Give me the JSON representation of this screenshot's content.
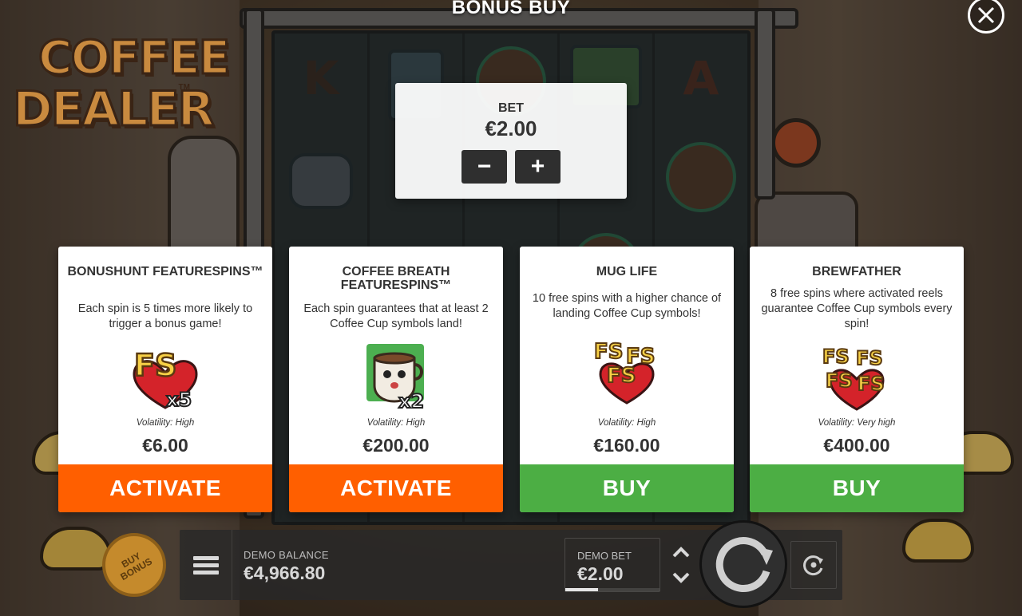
{
  "game": {
    "logo_line1": "COFFEE",
    "logo_line2": "DEALER",
    "logo_tm": "TM"
  },
  "reel_symbols": {
    "col1": [
      "K"
    ],
    "col5": [
      "A"
    ]
  },
  "modal": {
    "title": "BONUS BUY",
    "close_icon": "close-icon"
  },
  "bet": {
    "label": "BET",
    "value": "€2.00",
    "decrease_symbol": "−",
    "increase_symbol": "+"
  },
  "cards": [
    {
      "title": "BONUSHUNT FEATURESPINS™",
      "description": "Each spin is 5 times more likely to trigger a bonus game!",
      "icon": "fs-x5-icon",
      "icon_text": "FS",
      "icon_mult": "x5",
      "volatility": "Volatility: High",
      "price": "€6.00",
      "button": "ACTIVATE",
      "button_color": "#ff5f00"
    },
    {
      "title": "COFFEE BREATH FEATURESPINS™",
      "description": "Each spin guarantees that at least 2 Coffee Cup symbols land!",
      "icon": "coffee-cup-x2-icon",
      "icon_mult": "x2",
      "volatility": "Volatility: High",
      "price": "€200.00",
      "button": "ACTIVATE",
      "button_color": "#ff5f00"
    },
    {
      "title": "MUG LIFE",
      "description": "10 free spins with a higher chance of landing Coffee Cup symbols!",
      "icon": "fs-triple-icon",
      "icon_text": "FS",
      "volatility": "Volatility: High",
      "price": "€160.00",
      "button": "BUY",
      "button_color": "#4cae44"
    },
    {
      "title": "BREWFATHER",
      "description": "8 free spins where activated reels guarantee Coffee Cup symbols every spin!",
      "icon": "fs-quad-icon",
      "icon_text": "FS",
      "volatility": "Volatility: Very high",
      "price": "€400.00",
      "button": "BUY",
      "button_color": "#4cae44"
    }
  ],
  "bottom_bar": {
    "buy_bonus_line1": "BUY",
    "buy_bonus_line2": "BONUS",
    "balance_label": "DEMO BALANCE",
    "balance_value": "€4,966.80",
    "demo_bet_label": "DEMO BET",
    "demo_bet_value": "€2.00",
    "bet_level_fraction": 0.35,
    "arrow_up": "▲",
    "arrow_down": "▼"
  },
  "colors": {
    "activate": "#ff5f00",
    "buy": "#4cae44",
    "logo": "#c98a3f"
  }
}
